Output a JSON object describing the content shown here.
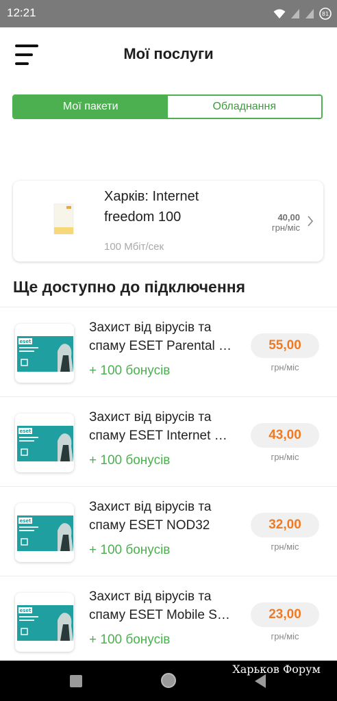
{
  "status_bar": {
    "time": "12:21",
    "icons": [
      "wifi-icon",
      "signal-icon",
      "signal-icon-2",
      "battery-icon"
    ]
  },
  "header": {
    "title": "Мої послуги",
    "menu_icon": "hamburger-menu-icon"
  },
  "tabs": [
    {
      "label": "Мої пакети",
      "active": true
    },
    {
      "label": "Обладнання",
      "active": false
    }
  ],
  "current_package": {
    "name_line1": "Харків: Internet",
    "name_line2": "freedom 100",
    "speed": "100 Мбіт/сек",
    "price": "40,00",
    "price_unit": "грн/міс"
  },
  "available_section": {
    "title": "Ще доступно до підключення"
  },
  "offers": [
    {
      "line1": "Захист від вірусів та",
      "line2": "спаму ESET Parental Control",
      "bonus": "+ 100 бонусів",
      "price": "55,00",
      "unit": "грн/міс",
      "box_label": "PARENTAL CONTROL"
    },
    {
      "line1": "Захист від вірусів та",
      "line2": "спаму ESET Internet Security",
      "bonus": "+ 100 бонусів",
      "price": "43,00",
      "unit": "грн/міс",
      "box_label": "INTERNET SECURITY"
    },
    {
      "line1": "Захист від вірусів та",
      "line2": "спаму ESET NOD32",
      "bonus": "+ 100 бонусів",
      "price": "32,00",
      "unit": "грн/міс",
      "box_label": "NOD32 ANTIVIRUS"
    },
    {
      "line1": "Захист від вірусів та",
      "line2": "спаму ESET Mobile Security",
      "bonus": "+ 100 бонусів",
      "price": "23,00",
      "unit": "грн/міс",
      "box_label": "MOBILE SECURITY"
    }
  ],
  "nav_bar": {
    "watermark": "Харьков Форум"
  },
  "colors": {
    "accent_green": "#4caf50",
    "price_orange": "#ee7a23",
    "eset_teal": "#1f9fa0"
  }
}
